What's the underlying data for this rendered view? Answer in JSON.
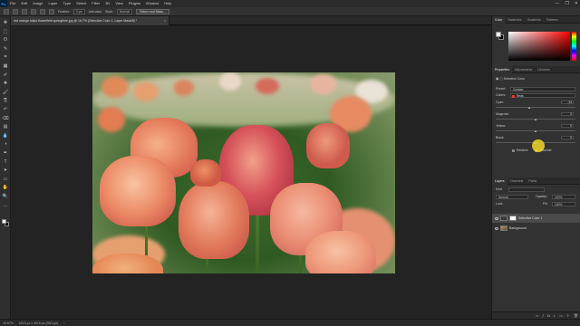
{
  "menubar": {
    "logo": "Ps",
    "items": [
      "File",
      "Edit",
      "Image",
      "Layer",
      "Type",
      "Select",
      "Filter",
      "3D",
      "View",
      "Plugins",
      "Window",
      "Help"
    ],
    "window_controls": [
      "—",
      "❐",
      "✕"
    ]
  },
  "options_bar": {
    "feather_label": "Feather:",
    "feather_value": "0 px",
    "anti_alias": "Anti-alias",
    "style_label": "Style:",
    "style_value": "Normal",
    "select_mask_button": "Select and Mask..."
  },
  "document": {
    "tab_label": "red orange tulips flowerfield springtime.jpg @ 16.7% (Selective Color 1, Layer Mask/8) *",
    "close": "×"
  },
  "status": {
    "zoom": "16.67%",
    "doc_info": "6016 px x 4016 px (300 ppi)"
  },
  "color_panel": {
    "tabs": [
      "Color",
      "Swatches",
      "Gradients",
      "Patterns"
    ],
    "active": 0,
    "fg": "#ffffff",
    "bg": "#000000"
  },
  "properties": {
    "tabs": [
      "Properties",
      "Adjustments",
      "Libraries"
    ],
    "active": 0,
    "title": "Selective Color",
    "preset_label": "Preset:",
    "preset_value": "Custom",
    "colors_label": "Colors:",
    "colors_value": "Reds",
    "colors_swatch": "#e23b2a",
    "sliders": [
      {
        "label": "Cyan:",
        "value": "-14",
        "fraction": 0.43
      },
      {
        "label": "Magenta:",
        "value": "0",
        "fraction": 0.5
      },
      {
        "label": "Yellow:",
        "value": "0",
        "fraction": 0.5
      },
      {
        "label": "Black:",
        "value": "0",
        "fraction": 0.5
      }
    ],
    "relative_label": "Relative",
    "absolute_label": "Absolute",
    "method_selected": "Absolute"
  },
  "layers": {
    "tabs": [
      "Layers",
      "Channels",
      "Paths"
    ],
    "active": 0,
    "kind_label": "Kind",
    "blend_mode": "Normal",
    "opacity_label": "Opacity:",
    "opacity_value": "100%",
    "lock_label": "Lock:",
    "fill_label": "Fill:",
    "fill_value": "100%",
    "items": [
      {
        "name": "Selective Color 1",
        "selected": true
      },
      {
        "name": "Background",
        "selected": false
      }
    ],
    "footer_icons": [
      "link-icon",
      "fx-icon",
      "mask-icon",
      "adjustment-icon",
      "folder-icon",
      "new-layer-icon",
      "trash-icon"
    ]
  },
  "toolbar": {
    "tools": [
      "move-icon",
      "marquee-icon",
      "lasso-icon",
      "quick-select-icon",
      "crop-icon",
      "frame-icon",
      "eyedropper-icon",
      "healing-icon",
      "brush-icon",
      "stamp-icon",
      "history-brush-icon",
      "eraser-icon",
      "gradient-icon",
      "blur-icon",
      "dodge-icon",
      "pen-icon",
      "type-icon",
      "path-select-icon",
      "rectangle-icon",
      "hand-icon",
      "zoom-icon",
      "more-icon"
    ]
  },
  "colors": {
    "accent": "#31a8ff",
    "panel_bg": "#323232",
    "canvas_bg": "#232323",
    "cursor_highlight": "#f0d728"
  }
}
